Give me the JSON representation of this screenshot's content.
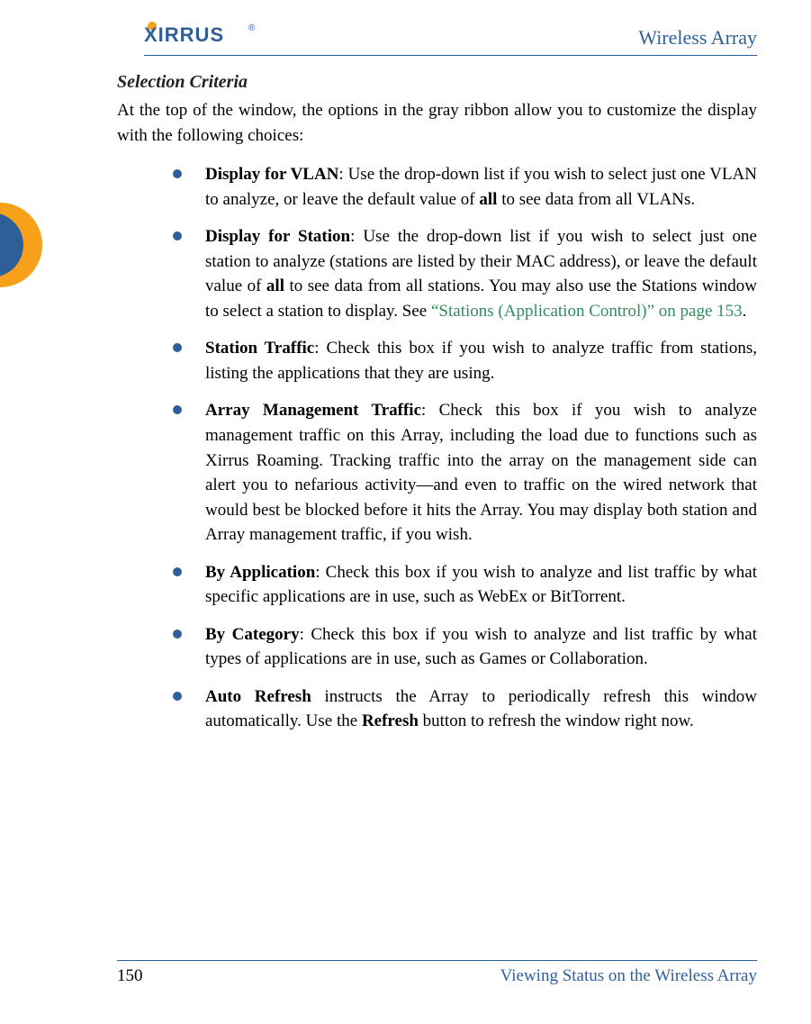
{
  "header": {
    "logo_text": "XIRRUS",
    "doc_title": "Wireless Array"
  },
  "section": {
    "heading": "Selection Criteria",
    "intro": "At the top of the window, the options in the gray ribbon allow you to customize the display with the following choices:"
  },
  "bullets": [
    {
      "lead": "Display for VLAN",
      "pre": ": Use the drop-down list if you wish to select just one VLAN to analyze, or leave the default value of ",
      "mid_bold": "all",
      "post": " to see data from all VLANs."
    },
    {
      "lead": "Display for Station",
      "pre": ": Use the drop-down list if you wish to select just one station to analyze (stations are listed by their MAC address), or leave the default value of ",
      "mid_bold": "all",
      "post": " to see data from all stations. You may also use the Stations window to select a station to display. See ",
      "link": "“Stations (Application Control)” on page 153",
      "tail": "."
    },
    {
      "lead": "Station Traffic",
      "pre": ": Check this box if you wish to analyze traffic from stations, listing the applications that they are using."
    },
    {
      "lead": "Array Management Traffic",
      "pre": ": Check this box if you wish to analyze management traffic on this Array, including the load due to functions such as Xirrus Roaming. Tracking traffic into the array on the management side can alert you to nefarious activity—and even to traffic on the wired network that would best be blocked before it hits the Array. You may display both station and Array management traffic, if you wish."
    },
    {
      "lead": "By Application",
      "pre": ": Check this box if you wish to analyze and list traffic by what specific applications are in use, such as WebEx or BitTorrent."
    },
    {
      "lead": "By Category",
      "pre": ": Check this box if you wish to analyze and list traffic by what types of applications are in use, such as Games or Collaboration."
    },
    {
      "lead": "Auto Refresh",
      "pre": " instructs the Array to periodically refresh this window automatically. Use the ",
      "mid_bold": "Refresh",
      "post": " button to refresh the window right now."
    }
  ],
  "footer": {
    "page": "150",
    "title": "Viewing Status on the Wireless Array"
  }
}
